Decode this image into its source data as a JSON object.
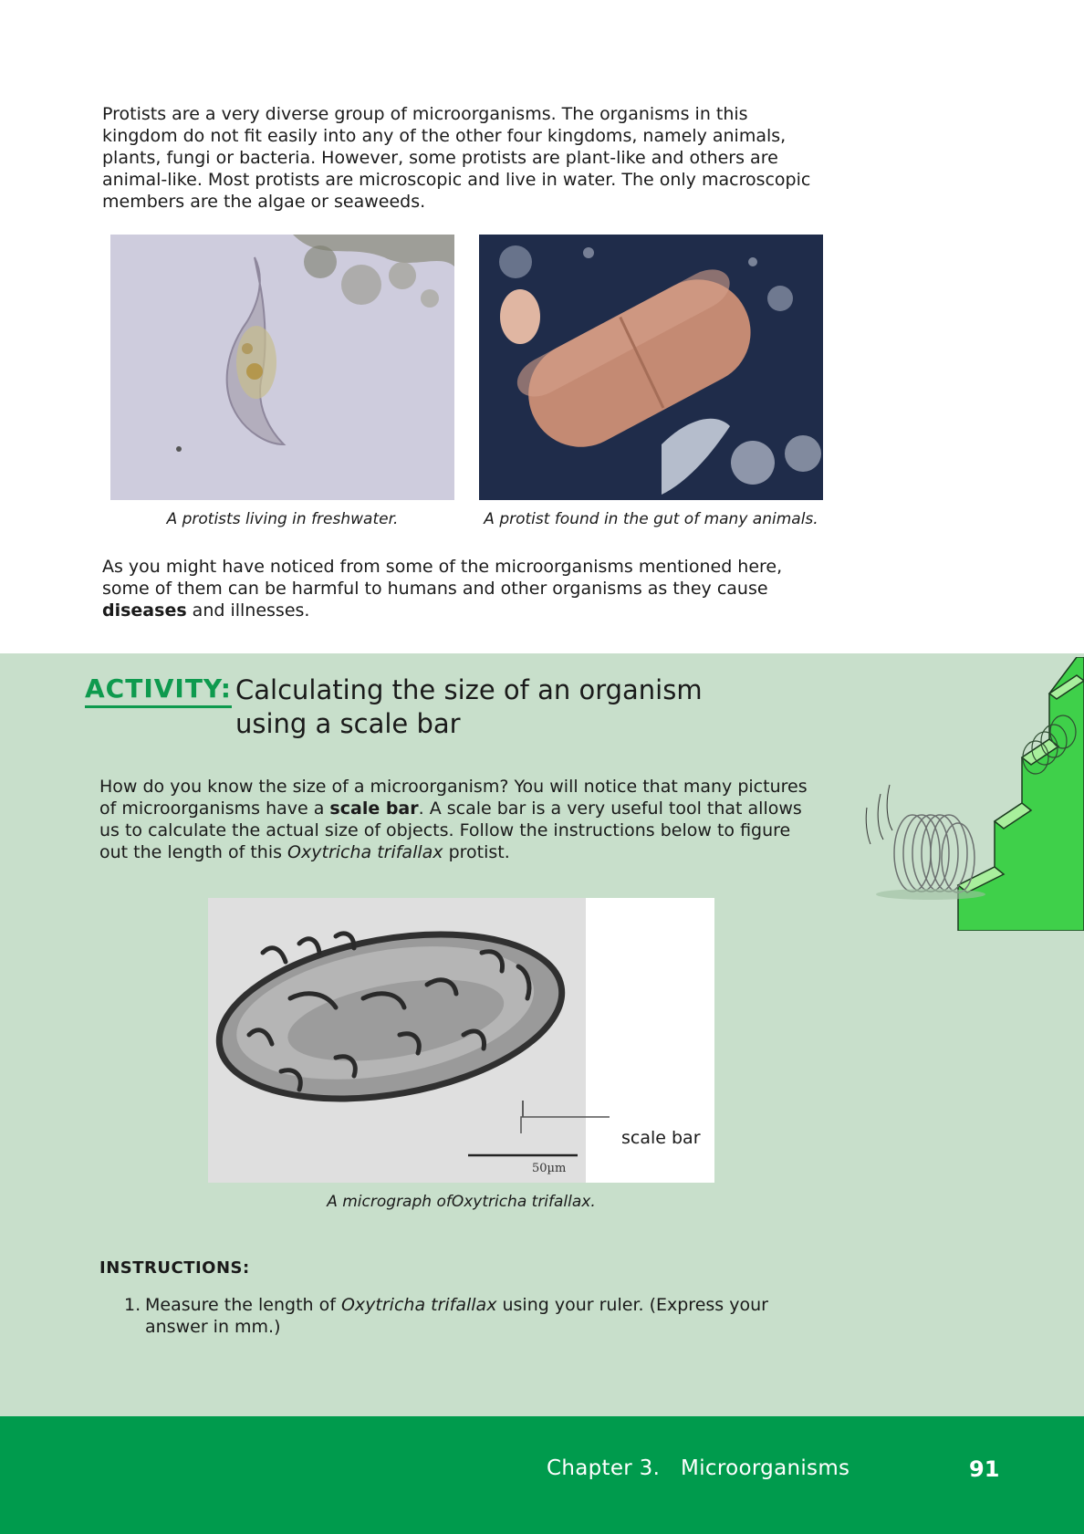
{
  "intro": "Protists are a very diverse group of microorganisms. The organisms in this kingdom do not fit easily into any of the other four kingdoms, namely animals, plants, fungi or bacteria. However, some protists are plant-like and others are animal-like. Most protists are microscopic and live in water. The only macroscopic members are the algae or seaweeds.",
  "photos": [
    {
      "caption": "A protists living in freshwater."
    },
    {
      "caption": "A protist found in the gut of many animals."
    }
  ],
  "harm": {
    "before": "As you might have noticed from some of the microorganisms mentioned here, some of them can be harmful to humans and other organisms as they cause ",
    "bold": "diseases",
    "after": " and illnesses."
  },
  "activity": {
    "label": "ACTIVITY:",
    "title": "Calculating the size of an organism using a scale bar",
    "body": {
      "p1": "How do you know the size of a microorganism? You will notice that many pictures of microorganisms have a ",
      "bold": "scale bar",
      "p2": ". A scale bar is a very useful tool that allows us to calculate the actual size of objects. Follow the instructions below to figure out the length of this ",
      "italic": "Oxytricha trifallax",
      "p3": " protist."
    },
    "micrograph": {
      "scale_text": "50µm",
      "scale_label": "scale bar",
      "caption": "A micrograph ofOxytricha trifallax."
    },
    "instructions_heading": "INSTRUCTIONS:",
    "instructions": [
      {
        "num": "1.",
        "before": "Measure the length of ",
        "italic": "Oxytricha trifallax",
        "after": " using your ruler. (Express your answer in mm.)"
      }
    ]
  },
  "footer": {
    "chapter": "Chapter 3.   Microorganisms",
    "page": "91"
  },
  "colors": {
    "activity_bg": "#c8dfcb",
    "accent_green": "#0e9a4e",
    "footer_green": "#009b4d"
  }
}
